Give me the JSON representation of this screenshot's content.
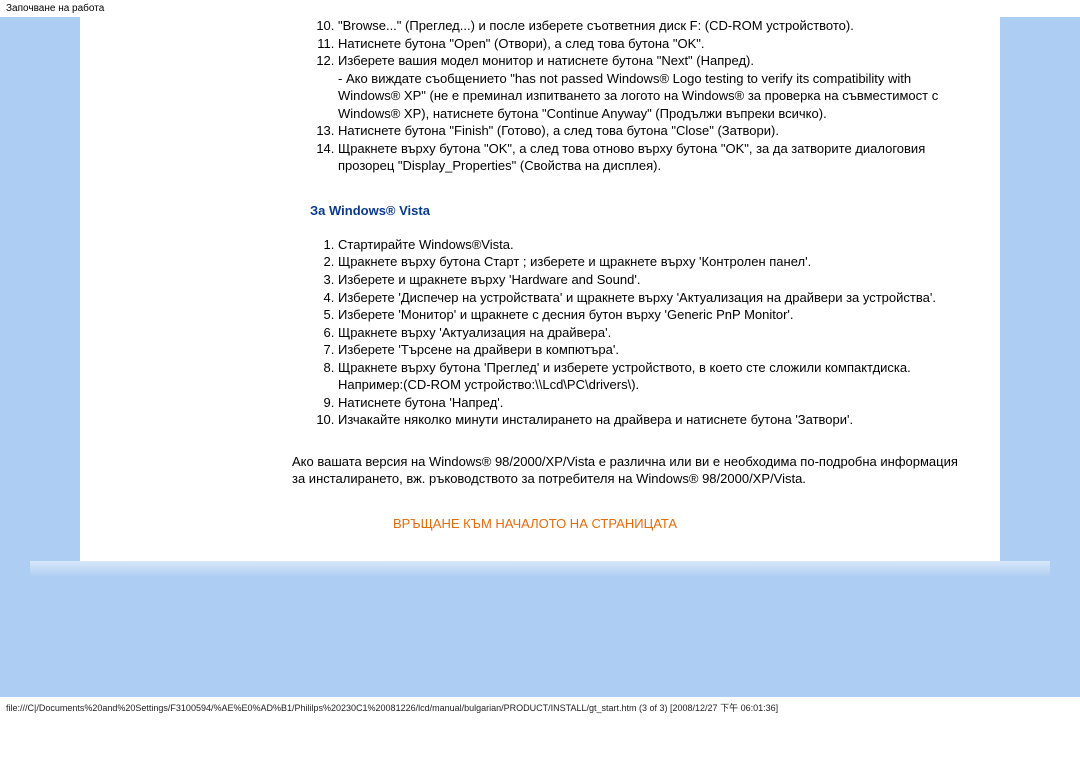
{
  "header": {
    "title": "Започване на работа"
  },
  "xp_list": {
    "start": 10,
    "items": [
      "\"Browse...\" (Преглед...) и после изберете съответния диск F: (CD-ROM устройството).",
      "Натиснете бутона \"Open\" (Отвори), а след това бутона \"OK\".",
      "Изберете вашия модел монитор и натиснете бутона \"Next\" (Напред).\n- Ако виждате съобщението \"has not passed Windows® Logo testing to verify its compatibility with Windows® XP\" (не е преминал изпитването за логото на Windows® за проверка на съвместимост с Windows® XP), натиснете бутона \"Continue Anyway\" (Продължи въпреки всичко).",
      "Натиснете бутона \"Finish\" (Готово), а след това бутона \"Close\" (Затвори).",
      "Щракнете върху бутона \"OK\", а след това отново върху бутона \"OK\", за да затворите диалоговия прозорец \"Display_Properties\" (Свойства на дисплея)."
    ]
  },
  "vista_heading": "За Windows® Vista",
  "vista_list": {
    "items": [
      "Стартирайте Windows®Vista.",
      "Щракнете върху бутона Старт ; изберете и щракнете върху 'Контролен панел'.",
      "Изберете и щракнете върху 'Hardware and Sound'.",
      "Изберете 'Диспечер на устройствата' и щракнете върху 'Актуализация на драйвери за устройства'.",
      "Изберете 'Монитор' и щракнете с десния бутон върху 'Generic PnP Monitor'.",
      "Щракнете върху 'Актуализация на драйвера'.",
      "Изберете 'Търсене на драйвери в компютъра'.",
      "Щракнете върху бутона 'Преглед' и изберете устройството, в което сте сложили компактдиска. Например:(CD-ROM устройство:\\\\Lcd\\PC\\drivers\\).",
      "Натиснете бутона 'Напред'.",
      "Изчакайте няколко минути инсталирането на драйвера и натиснете бутона 'Затвори'."
    ]
  },
  "note": "Ако вашата версия на Windows® 98/2000/XP/Vista е различна или ви е необходима по-подробна информация за инсталирането, вж. ръководството за потребителя на Windows® 98/2000/XP/Vista.",
  "back_link": "ВРЪЩАНЕ КЪМ НАЧАЛОТО НА СТРАНИЦАТА",
  "file_path": "file:///C|/Documents%20and%20Settings/F3100594/%AE%E0%AD%B1/Phililps%20230C1%20081226/lcd/manual/bulgarian/PRODUCT/INSTALL/gt_start.htm (3 of 3) [2008/12/27 下午 06:01:36]"
}
